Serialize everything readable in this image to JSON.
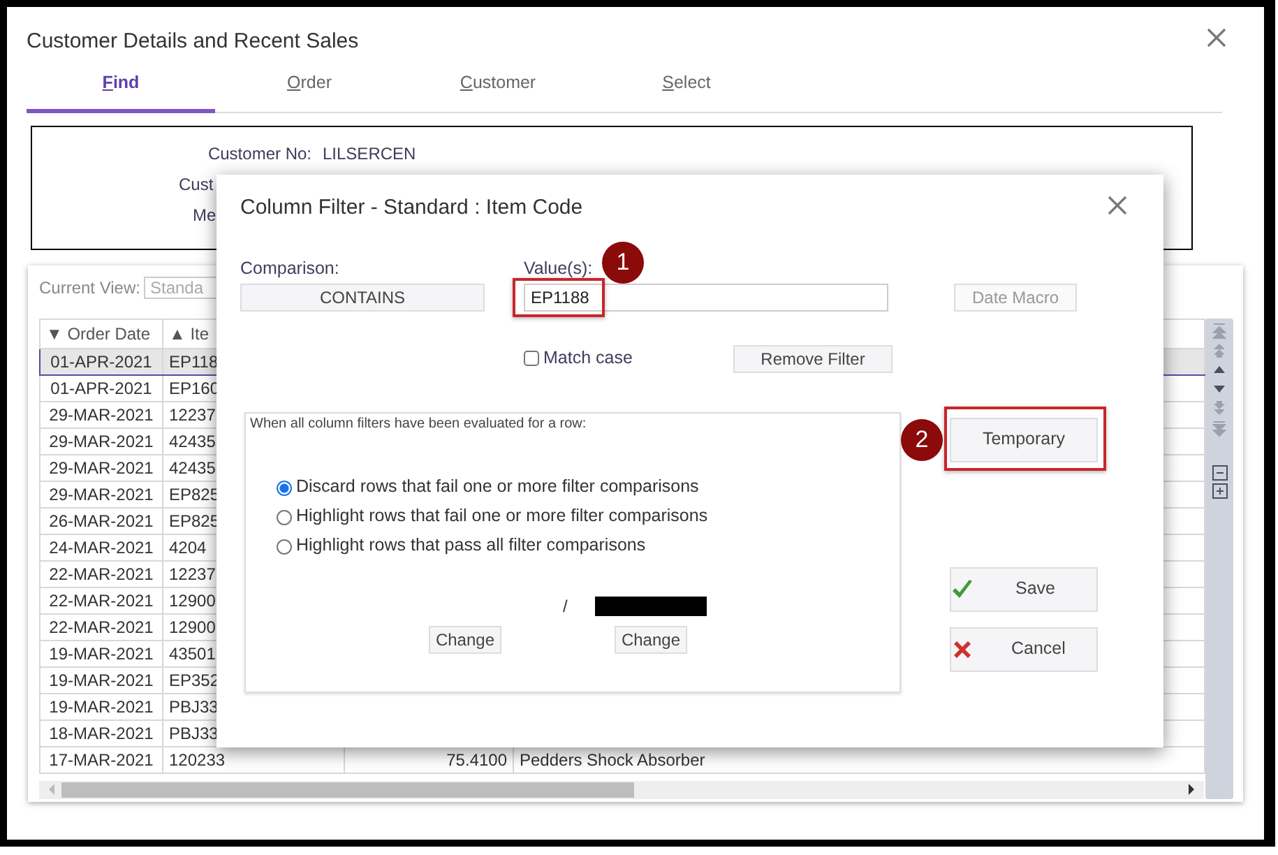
{
  "window": {
    "title": "Customer Details and Recent Sales"
  },
  "tabs": [
    {
      "label": "Find",
      "selected": true
    },
    {
      "label": "Order",
      "selected": false
    },
    {
      "label": "Customer",
      "selected": false
    },
    {
      "label": "Select",
      "selected": false
    }
  ],
  "customer": [
    {
      "label": "Customer No:",
      "value": "LILSERCEN"
    },
    {
      "label": "Cust"
    },
    {
      "label": "Me"
    }
  ],
  "grid": {
    "current_view": {
      "label": "Current View:",
      "value": "Standa"
    },
    "columns": [
      "▼ Order Date",
      "▲ Ite"
    ],
    "rows": [
      {
        "date": "01-APR-2021",
        "item": "EP118",
        "selected": true
      },
      {
        "date": "01-APR-2021",
        "item": "EP160",
        "selected": false
      },
      {
        "date": "29-MAR-2021",
        "item": "12237",
        "selected": false
      },
      {
        "date": "29-MAR-2021",
        "item": "42435",
        "selected": false
      },
      {
        "date": "29-MAR-2021",
        "item": "42435",
        "selected": false
      },
      {
        "date": "29-MAR-2021",
        "item": "EP825",
        "selected": false
      },
      {
        "date": "26-MAR-2021",
        "item": "EP825",
        "selected": false
      },
      {
        "date": "24-MAR-2021",
        "item": "4204",
        "selected": false
      },
      {
        "date": "22-MAR-2021",
        "item": "12237",
        "selected": false
      },
      {
        "date": "22-MAR-2021",
        "item": "12900",
        "selected": false
      },
      {
        "date": "22-MAR-2021",
        "item": "12900",
        "selected": false
      },
      {
        "date": "19-MAR-2021",
        "item": "43501",
        "selected": false
      },
      {
        "date": "19-MAR-2021",
        "item": "EP352",
        "selected": false
      },
      {
        "date": "19-MAR-2021",
        "item": "PBJ33",
        "selected": false
      },
      {
        "date": "18-MAR-2021",
        "item": "PBJ33",
        "selected": false
      },
      {
        "date": "17-MAR-2021",
        "item": "120233",
        "amount": "75.4100",
        "description": "Pedders Shock Absorber",
        "selected": false
      }
    ],
    "toolbar": [
      {
        "kind": "first",
        "disabled": true
      },
      {
        "kind": "page-up",
        "disabled": true
      },
      {
        "kind": "up",
        "disabled": false
      },
      {
        "kind": "down",
        "disabled": false
      },
      {
        "kind": "page-down",
        "disabled": true
      },
      {
        "kind": "last",
        "disabled": true
      },
      {
        "kind": "collapse",
        "disabled": false
      },
      {
        "kind": "expand",
        "disabled": false
      }
    ]
  },
  "dialog": {
    "title": "Column Filter - Standard : Item Code",
    "comparison": {
      "label": "Comparison:",
      "value": "CONTAINS"
    },
    "values": {
      "label": "Value(s):",
      "value": "EP1188",
      "highlighted": true
    },
    "date_macro": {
      "label": "Date Macro",
      "disabled": true
    },
    "match_case": {
      "label": "Match case",
      "checked": false
    },
    "remove_filter": "Remove Filter",
    "options": {
      "legend": "When all column filters have been evaluated for a row:",
      "choices": [
        {
          "label": "Discard rows that fail one or more filter comparisons",
          "selected": true
        },
        {
          "label": "Highlight rows that fail one or more filter comparisons",
          "selected": false
        },
        {
          "label": "Highlight rows that pass all filter comparisons",
          "selected": false
        }
      ],
      "separator": "/",
      "redacted": true,
      "change_buttons": [
        "Change",
        "Change"
      ]
    },
    "temporary": {
      "label": "Temporary",
      "highlighted": true
    },
    "save": "Save",
    "cancel": "Cancel"
  },
  "callouts": [
    {
      "number": "1"
    },
    {
      "number": "2"
    }
  ]
}
